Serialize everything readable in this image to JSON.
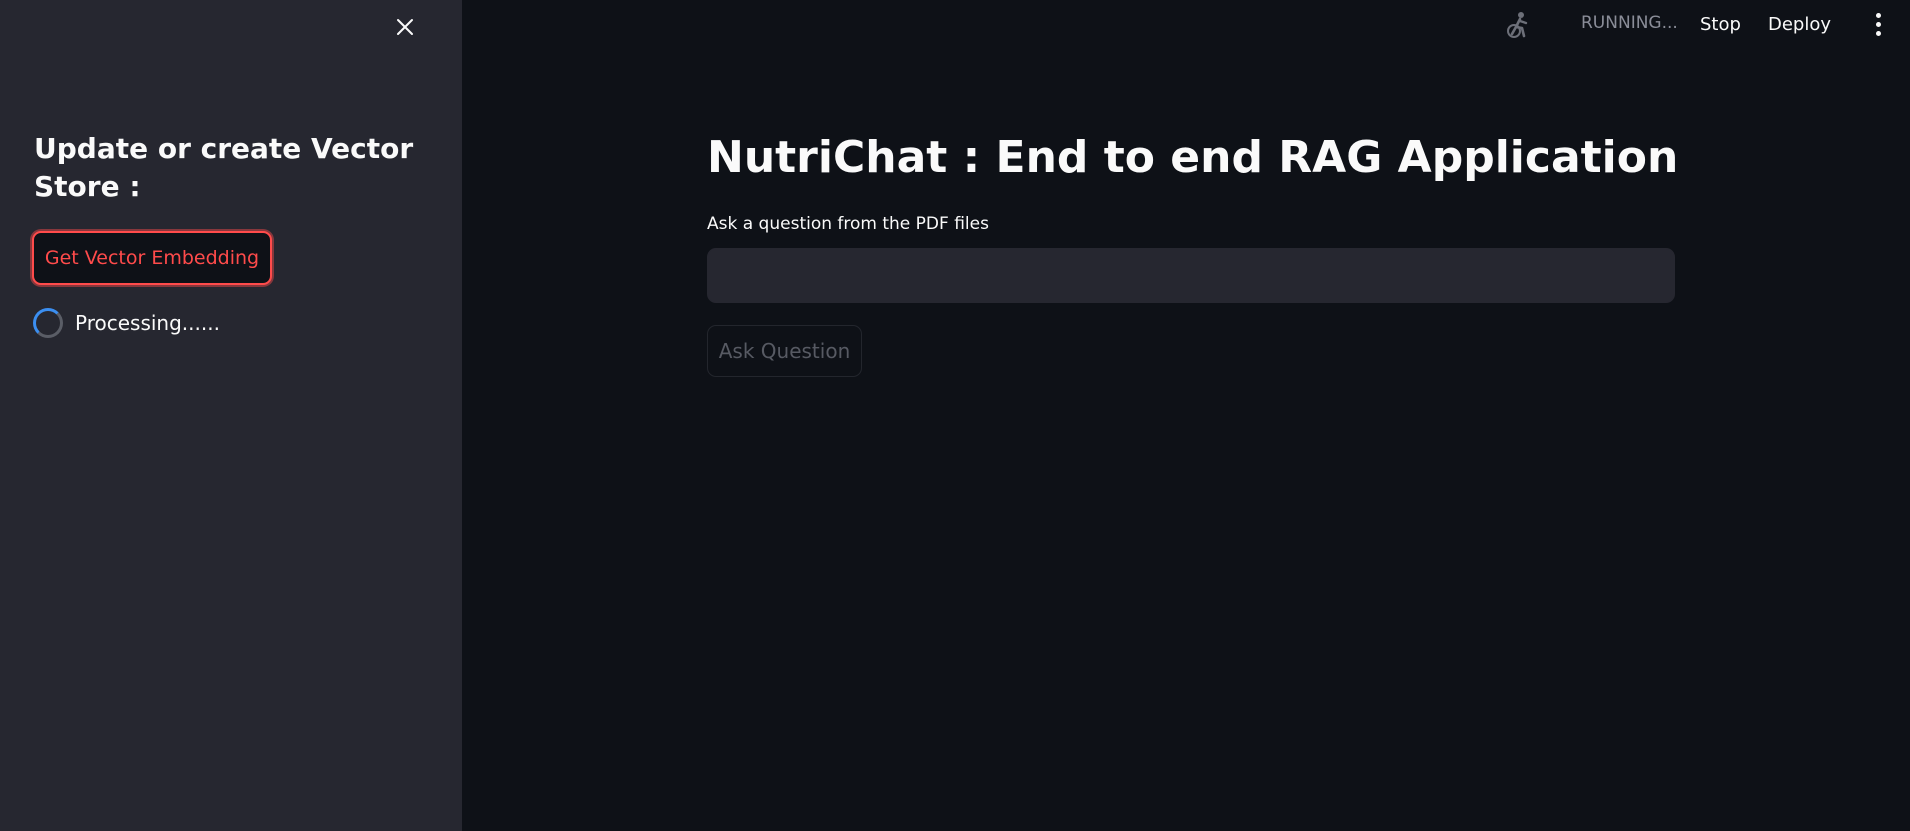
{
  "sidebar": {
    "close_icon": "close-icon",
    "heading": "Update or create Vector Store :",
    "embed_button_label": "Get Vector Embedding",
    "processing_text": "Processing......",
    "accent_color": "#ff4b4b",
    "spinner_color": "#3b8ef0"
  },
  "header": {
    "status_icon": "running-man-icon",
    "status_text": "RUNNING...",
    "stop_label": "Stop",
    "deploy_label": "Deploy",
    "menu_icon": "vertical-dots-icon"
  },
  "main": {
    "title": "NutriChat : End to end RAG Application",
    "input_label": "Ask a question from the PDF files",
    "input_value": "",
    "ask_button_label": "Ask Question",
    "ask_button_disabled": true
  },
  "colors": {
    "background": "#0e1117",
    "sidebar_background": "#262730",
    "text": "#fafafa"
  }
}
